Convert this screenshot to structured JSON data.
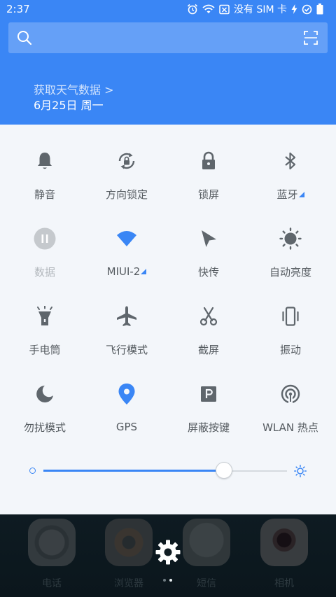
{
  "status_bar": {
    "time": "2:37",
    "carrier": "没有 SIM 卡",
    "icons": [
      "alarm-icon",
      "wifi-icon",
      "no-sim-icon",
      "charging-icon",
      "sync-icon",
      "battery-icon"
    ]
  },
  "search": {
    "placeholder": "",
    "icon": "search-icon",
    "scan_icon": "scan-icon"
  },
  "weather": {
    "link": "获取天气数据 >",
    "date": "6月25日 周一"
  },
  "quick_settings": {
    "tiles": [
      {
        "id": "mute",
        "label": "静音",
        "icon": "bell-icon",
        "active": false
      },
      {
        "id": "rotation-lock",
        "label": "方向锁定",
        "icon": "rotation-lock-icon",
        "active": false
      },
      {
        "id": "lock-screen",
        "label": "锁屏",
        "icon": "lock-icon",
        "active": false
      },
      {
        "id": "bluetooth",
        "label": "蓝牙",
        "icon": "bluetooth-icon",
        "active": false,
        "expandable": true
      },
      {
        "id": "data",
        "label": "数据",
        "icon": "pause-icon",
        "active": false,
        "disabled": true
      },
      {
        "id": "wifi",
        "label": "MIUI-2",
        "icon": "wifi-icon",
        "active": true,
        "expandable": true
      },
      {
        "id": "quick-share",
        "label": "快传",
        "icon": "share-arrow-icon",
        "active": false
      },
      {
        "id": "auto-brightness",
        "label": "自动亮度",
        "icon": "sun-icon",
        "active": false
      },
      {
        "id": "flashlight",
        "label": "手电筒",
        "icon": "flashlight-icon",
        "active": false
      },
      {
        "id": "airplane",
        "label": "飞行模式",
        "icon": "airplane-icon",
        "active": false
      },
      {
        "id": "screenshot",
        "label": "截屏",
        "icon": "scissors-icon",
        "active": false
      },
      {
        "id": "vibrate",
        "label": "振动",
        "icon": "vibrate-icon",
        "active": false
      },
      {
        "id": "dnd",
        "label": "勿扰模式",
        "icon": "moon-icon",
        "active": false
      },
      {
        "id": "gps",
        "label": "GPS",
        "icon": "location-pin-icon",
        "active": true
      },
      {
        "id": "block-keys",
        "label": "屏蔽按键",
        "icon": "parking-key-icon",
        "active": false
      },
      {
        "id": "hotspot",
        "label": "WLAN 热点",
        "icon": "hotspot-icon",
        "active": false
      }
    ]
  },
  "brightness": {
    "level": 0.74
  },
  "dock": {
    "apps": [
      {
        "label": "电话",
        "icon": "phone-app-icon"
      },
      {
        "label": "浏览器",
        "icon": "browser-app-icon"
      },
      {
        "label": "短信",
        "icon": "messages-app-icon"
      },
      {
        "label": "相机",
        "icon": "camera-app-icon"
      }
    ],
    "settings_icon": "gear-icon",
    "pages": 2,
    "current_page": 2
  },
  "colors": {
    "accent": "#3a86f5",
    "icon_gray": "#5f666c",
    "label_gray": "#555b60",
    "panel_bg": "#f3f6fa"
  }
}
